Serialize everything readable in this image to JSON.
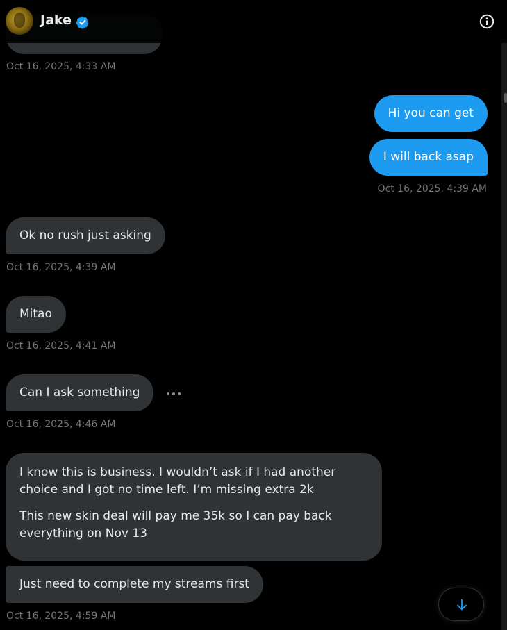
{
  "header": {
    "name": "Jake",
    "verified": true,
    "avatar_icon": "avatar",
    "info_icon": "info-icon"
  },
  "colors": {
    "background": "#000000",
    "received_bubble": "#2f3336",
    "sent_bubble": "#1d9bf0",
    "timestamp": "#71767b",
    "verified_badge": "#1d9bf0"
  },
  "messages": {
    "ts_top": "Oct 16, 2025, 4:33 AM",
    "sent_1": "Hi you can get",
    "sent_2": "I will back asap",
    "ts_sent": "Oct 16, 2025, 4:39 AM",
    "recv_1": "Ok no rush just asking",
    "ts_recv_1": "Oct 16, 2025, 4:39 AM",
    "recv_2": "Mitao",
    "ts_recv_2": "Oct 16, 2025, 4:41 AM",
    "recv_3": "Can I ask something",
    "ts_recv_3": "Oct 16, 2025, 4:46 AM",
    "recv_4_line_1": "I know this is business. I wouldn’t ask if I had another choice and I got no time left. I’m missing extra 2k",
    "recv_4_line_2": "This new skin deal will pay me 35k so I can pay back everything on Nov 13",
    "recv_5": "Just need to complete my streams first",
    "ts_recv_5": "Oct 16, 2025, 4:59 AM"
  },
  "controls": {
    "more_icon": "more-horizontal-icon",
    "scroll_down_icon": "arrow-down-icon"
  }
}
